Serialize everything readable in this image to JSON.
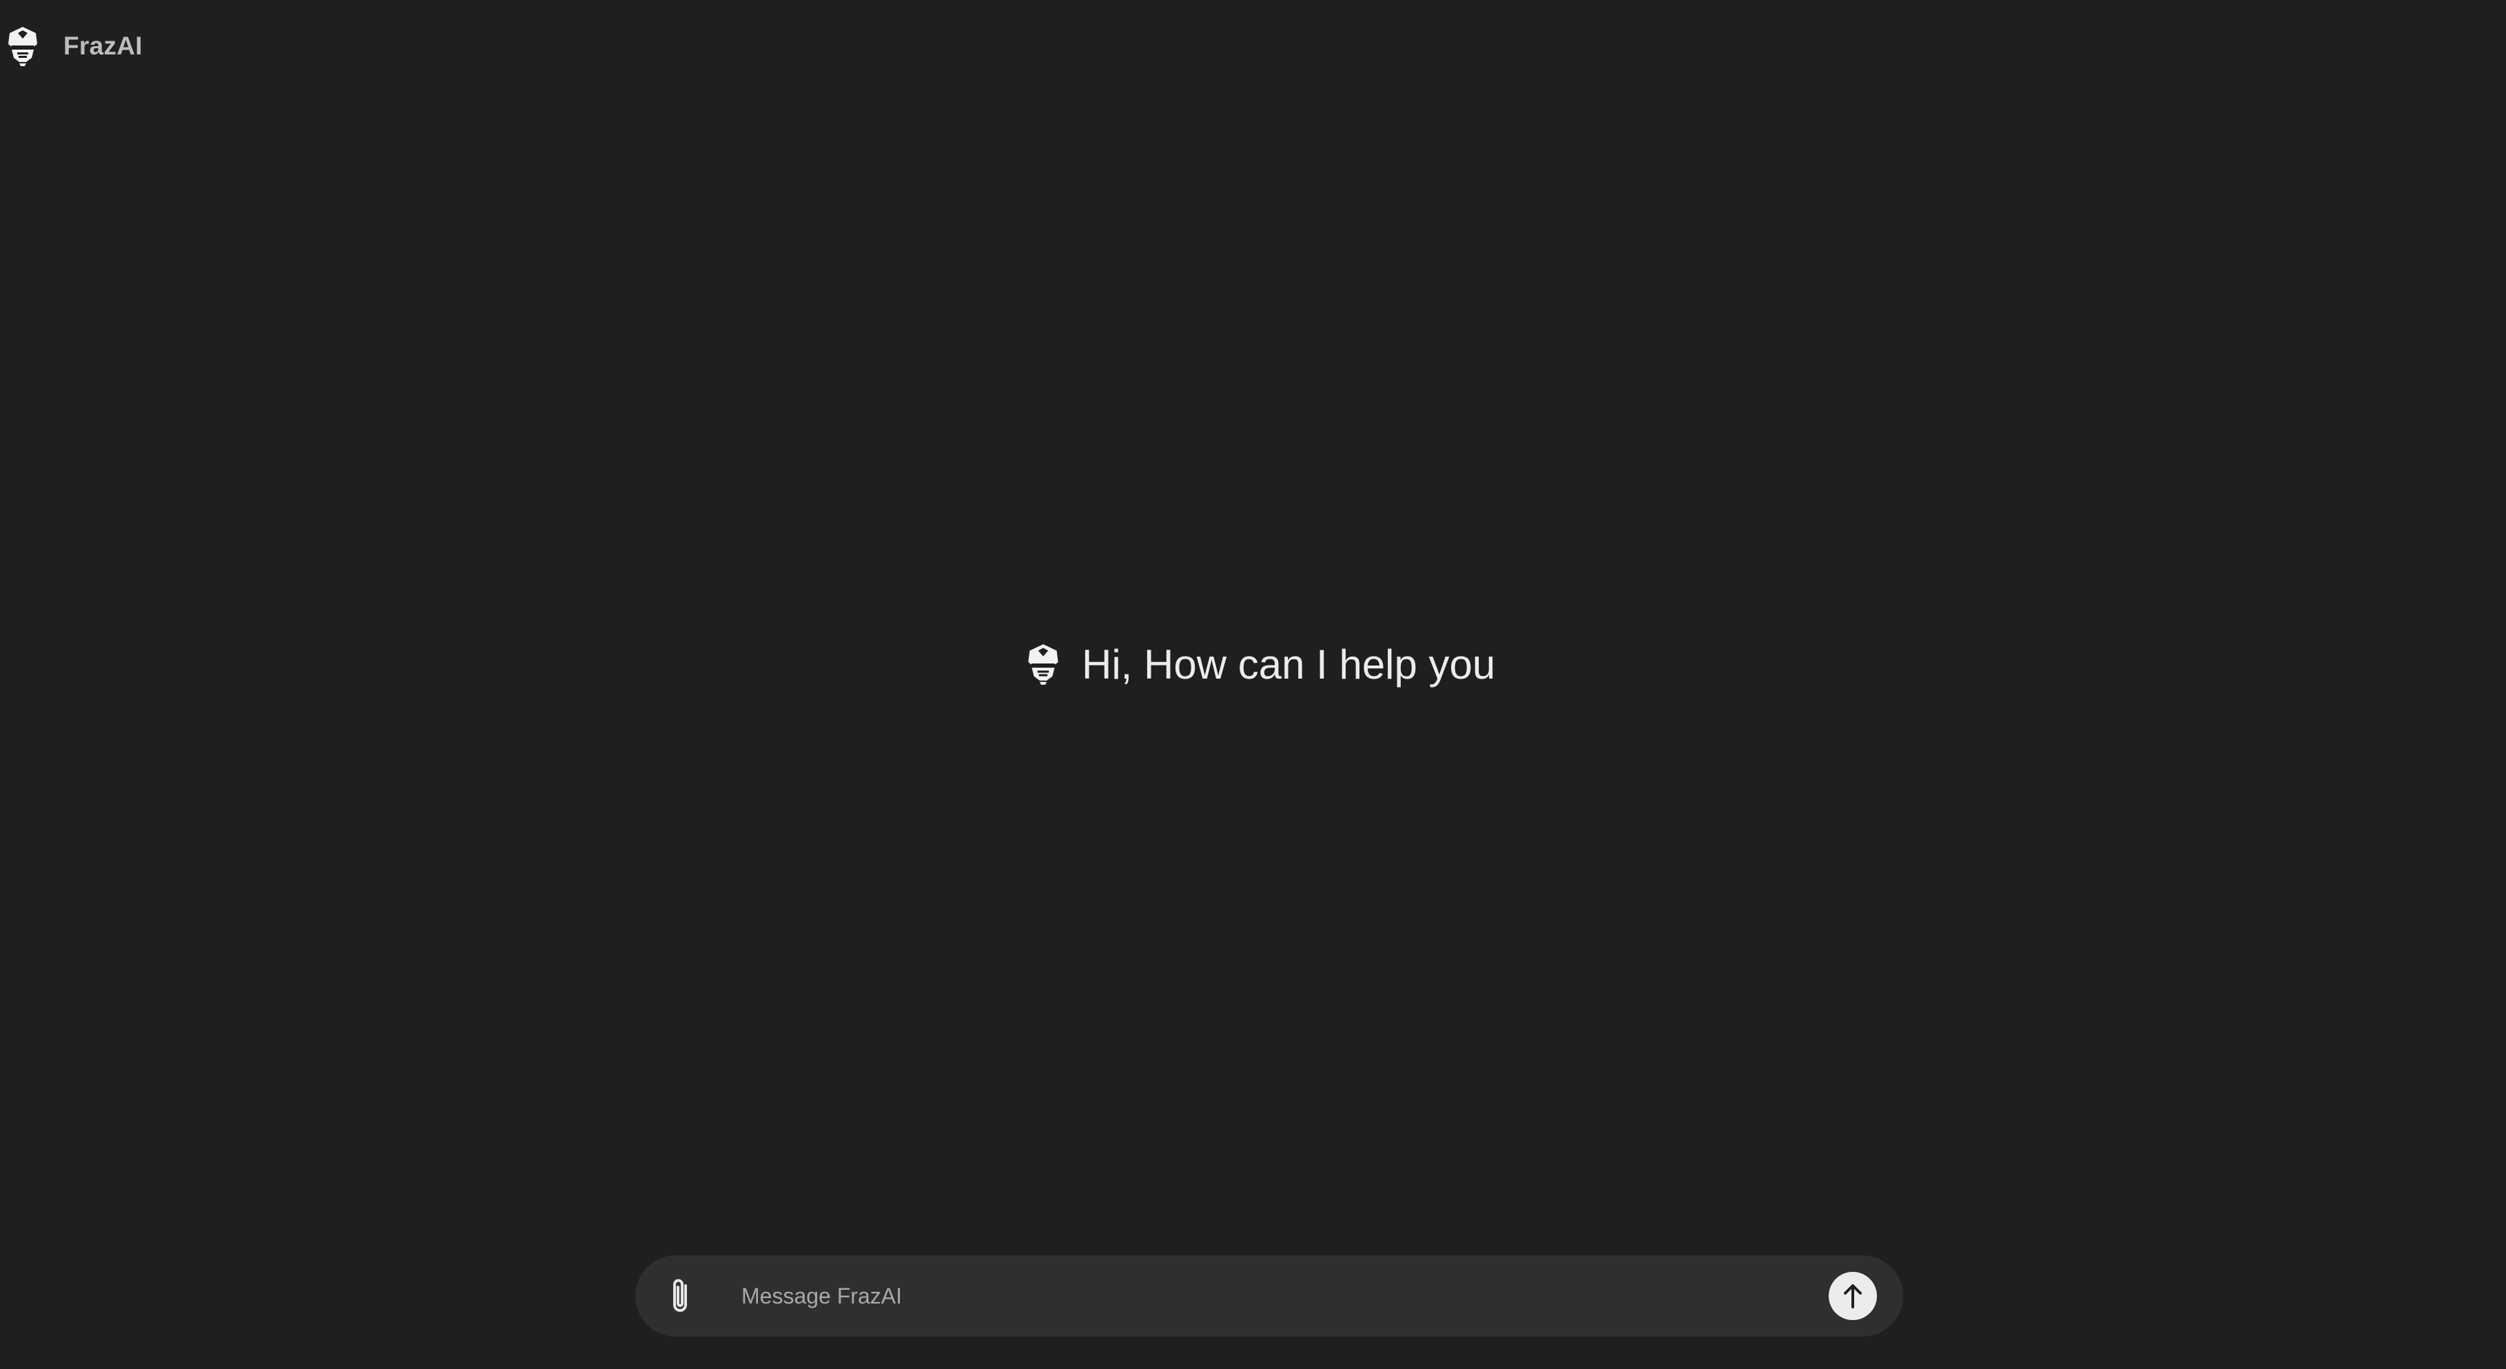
{
  "header": {
    "title": "FrazAI",
    "logo_icon": "robot-helmet-icon"
  },
  "greeting": {
    "text": "Hi, How can I help you",
    "logo_icon": "robot-helmet-icon"
  },
  "composer": {
    "placeholder": "Message FrazAI",
    "value": "",
    "attach_icon": "paperclip-icon",
    "send_icon": "arrow-up-icon"
  },
  "colors": {
    "background": "#1f1f1f",
    "composer_background": "#2f2f2f",
    "send_button": "#ececec",
    "text": "#ececec",
    "muted_text": "#a8a8a8"
  }
}
